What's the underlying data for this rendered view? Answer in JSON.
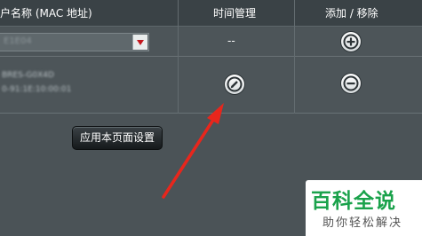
{
  "table": {
    "headers": {
      "client_name": "户名称 (MAC 地址)",
      "time_management": "时间管理",
      "add_remove": "添加 / 移除"
    },
    "row1": {
      "select_value": "E1E04",
      "time_value": "--"
    },
    "row2": {
      "client_name": "BRES-G0X4D",
      "client_mac": "0-91:1E:10:00:01"
    }
  },
  "apply_button_label": "应用本页面设置",
  "icons": {
    "add": "plus-circle-icon",
    "edit": "pencil-circle-icon",
    "remove": "minus-circle-icon",
    "dropdown": "chevron-down-icon"
  },
  "colors": {
    "background": "#4b5357",
    "header": "#3a4246",
    "arrow": "#e8261c",
    "dropdown_arrow": "#c4161c",
    "watermark_green": "#1aa24b"
  },
  "watermark": {
    "title": "百科全说",
    "subtitle": "助你轻松解决"
  }
}
